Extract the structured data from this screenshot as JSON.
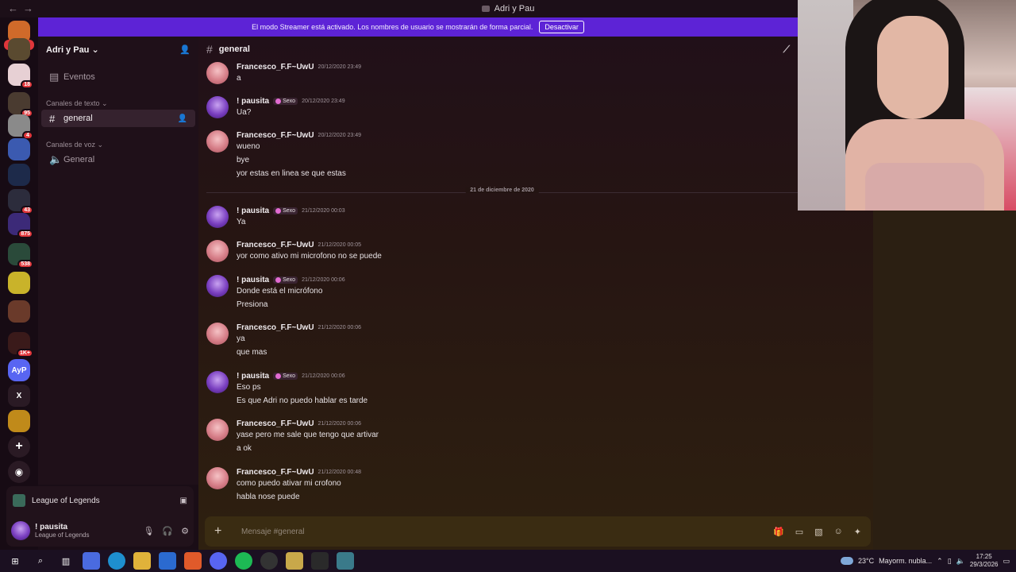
{
  "window": {
    "title": "Adri y Pau"
  },
  "streamer_banner": {
    "text": "El modo Streamer está activado. Los nombres de usuario se mostrarán de forma parcial.",
    "button": "Desactivar"
  },
  "guild_bar": {
    "new_badge": "NUEVO",
    "badges": [
      "18",
      "95",
      "4",
      "43",
      "875",
      "538",
      "1K+"
    ],
    "ayp_label": "AyP",
    "x_label": "X"
  },
  "sidebar": {
    "server_name": "Adri y Pau",
    "events_label": "Eventos",
    "text_category": "Canales de texto",
    "text_channel": "general",
    "voice_category": "Canales de voz",
    "voice_channel": "General"
  },
  "activity": {
    "game": "League of Legends"
  },
  "user_panel": {
    "name": "! pausita",
    "status": "League of Legends"
  },
  "channel_header": {
    "name": "general"
  },
  "date_divider": "21 de diciembre de 2020",
  "messages": [
    {
      "author": "Francesco_F.F~UwU",
      "time": "20/12/2020 23:49",
      "tag": "",
      "lines": [
        "a"
      ]
    },
    {
      "author": "! pausita",
      "time": "20/12/2020 23:49",
      "tag": "Sexo",
      "lines": [
        "Ua?"
      ]
    },
    {
      "author": "Francesco_F.F~UwU",
      "time": "20/12/2020 23:49",
      "tag": "",
      "lines": [
        "wueno",
        "bye",
        "yor estas en linea se que estas"
      ]
    },
    {
      "author": "! pausita",
      "time": "21/12/2020 00:03",
      "tag": "Sexo",
      "lines": [
        "Ya"
      ]
    },
    {
      "author": "Francesco_F.F~UwU",
      "time": "21/12/2020 00:05",
      "tag": "",
      "lines": [
        "yor como ativo mi microfono no se puede"
      ]
    },
    {
      "author": "! pausita",
      "time": "21/12/2020 00:06",
      "tag": "Sexo",
      "lines": [
        "Donde está el micrófono",
        "Presiona"
      ]
    },
    {
      "author": "Francesco_F.F~UwU",
      "time": "21/12/2020 00:06",
      "tag": "",
      "lines": [
        "ya",
        "que mas"
      ]
    },
    {
      "author": "! pausita",
      "time": "21/12/2020 00:06",
      "tag": "Sexo",
      "lines": [
        "Eso ps",
        "Es que Adri no puedo hablar es tarde"
      ]
    },
    {
      "author": "Francesco_F.F~UwU",
      "time": "21/12/2020 00:06",
      "tag": "",
      "lines": [
        "yase pero me sale que tengo que artivar",
        "a ok"
      ]
    },
    {
      "author": "Francesco_F.F~UwU",
      "time": "21/12/2020 00:48",
      "tag": "",
      "lines": [
        "como puedo ativar mi crofono",
        "habla nose puede"
      ]
    }
  ],
  "composer": {
    "placeholder": "Mensaje #general"
  },
  "taskbar": {
    "weather": "23°C",
    "weather_desc": "Mayorm. nubla...",
    "time": "17:25",
    "date": "29/3/2026"
  }
}
